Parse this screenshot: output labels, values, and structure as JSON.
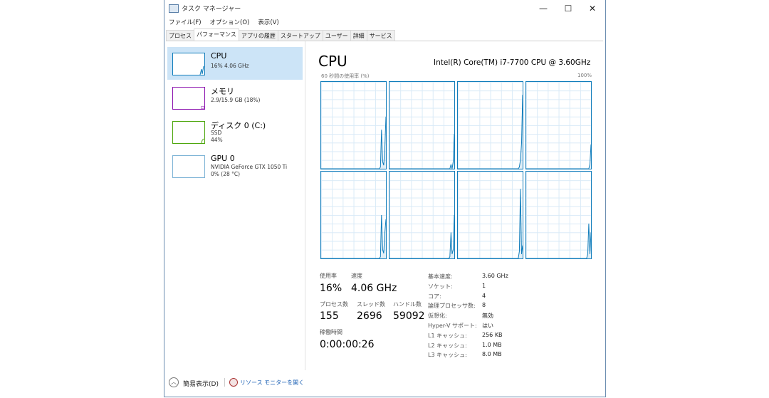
{
  "window": {
    "title": "タスク マネージャー",
    "minimize": "—",
    "maximize": "☐",
    "close": "✕"
  },
  "menu": [
    "ファイル(F)",
    "オプション(O)",
    "表示(V)"
  ],
  "tabs": [
    {
      "label": "プロセス"
    },
    {
      "label": "パフォーマンス",
      "active": true
    },
    {
      "label": "アプリの履歴"
    },
    {
      "label": "スタートアップ"
    },
    {
      "label": "ユーザー"
    },
    {
      "label": "詳細"
    },
    {
      "label": "サービス"
    }
  ],
  "sidebar": [
    {
      "name": "CPU",
      "line1": "16%  4.06 GHz",
      "color": "#117dbb"
    },
    {
      "name": "メモリ",
      "line1": "2.9/15.9 GB (18%)",
      "color": "#8b12ae"
    },
    {
      "name": "ディスク 0 (C:)",
      "line1": "SSD",
      "line2": "44%",
      "color": "#4da60c"
    },
    {
      "name": "GPU 0",
      "line1": "NVIDIA GeForce GTX 1050 Ti",
      "line2": "0%  (28 °C)",
      "color": "#7eb4d6"
    }
  ],
  "main": {
    "title": "CPU",
    "model": "Intel(R) Core(TM) i7-7700 CPU @ 3.60GHz",
    "graph_label": "60 秒間の使用率 (%)",
    "max_label": "100%",
    "core_history": [
      [
        0,
        0,
        0,
        0,
        0,
        0,
        0,
        0,
        0,
        0,
        0,
        0,
        0,
        0,
        0,
        0,
        0,
        0,
        0,
        0,
        0,
        0,
        0,
        0,
        0,
        0,
        0,
        0,
        0,
        0,
        0,
        0,
        0,
        0,
        0,
        0,
        0,
        0,
        0,
        0,
        0,
        0,
        0,
        0,
        0,
        0,
        0,
        0,
        0,
        0,
        0,
        0,
        0,
        0,
        2,
        45,
        8,
        4,
        25,
        60
      ],
      [
        0,
        0,
        0,
        0,
        0,
        0,
        0,
        0,
        0,
        0,
        0,
        0,
        0,
        0,
        0,
        0,
        0,
        0,
        0,
        0,
        0,
        0,
        0,
        0,
        0,
        0,
        0,
        0,
        0,
        0,
        0,
        0,
        0,
        0,
        0,
        0,
        0,
        0,
        0,
        0,
        0,
        0,
        0,
        0,
        0,
        0,
        0,
        0,
        0,
        0,
        0,
        0,
        0,
        0,
        0,
        0,
        5,
        0,
        8,
        40
      ],
      [
        0,
        0,
        0,
        0,
        0,
        0,
        0,
        0,
        0,
        0,
        0,
        0,
        0,
        0,
        0,
        0,
        0,
        0,
        0,
        0,
        0,
        0,
        0,
        0,
        0,
        0,
        0,
        0,
        0,
        0,
        0,
        0,
        0,
        0,
        0,
        0,
        0,
        0,
        0,
        0,
        0,
        0,
        0,
        0,
        0,
        0,
        0,
        0,
        0,
        0,
        0,
        0,
        0,
        0,
        0,
        0,
        2,
        10,
        30,
        85
      ],
      [
        0,
        0,
        0,
        0,
        0,
        0,
        0,
        0,
        0,
        0,
        0,
        0,
        0,
        0,
        0,
        0,
        0,
        0,
        0,
        0,
        0,
        0,
        0,
        0,
        0,
        0,
        0,
        0,
        0,
        0,
        0,
        0,
        0,
        0,
        0,
        0,
        0,
        0,
        0,
        0,
        0,
        0,
        0,
        0,
        0,
        0,
        0,
        0,
        0,
        0,
        0,
        0,
        0,
        0,
        0,
        0,
        0,
        0,
        5,
        28
      ],
      [
        0,
        0,
        0,
        0,
        0,
        0,
        0,
        0,
        0,
        0,
        0,
        0,
        0,
        0,
        0,
        0,
        0,
        0,
        0,
        0,
        0,
        0,
        0,
        0,
        0,
        0,
        0,
        0,
        0,
        0,
        0,
        0,
        0,
        0,
        0,
        0,
        0,
        0,
        0,
        0,
        0,
        0,
        0,
        0,
        0,
        0,
        0,
        0,
        0,
        0,
        0,
        0,
        0,
        0,
        2,
        50,
        10,
        6,
        30,
        45
      ],
      [
        0,
        0,
        0,
        0,
        0,
        0,
        0,
        0,
        0,
        0,
        0,
        0,
        0,
        0,
        0,
        0,
        0,
        0,
        0,
        0,
        0,
        0,
        0,
        0,
        0,
        0,
        0,
        0,
        0,
        0,
        0,
        0,
        0,
        0,
        0,
        0,
        0,
        0,
        0,
        0,
        0,
        0,
        0,
        0,
        0,
        0,
        0,
        0,
        0,
        0,
        0,
        0,
        0,
        0,
        0,
        2,
        30,
        5,
        10,
        50
      ],
      [
        0,
        0,
        0,
        0,
        0,
        0,
        0,
        0,
        0,
        0,
        0,
        0,
        0,
        0,
        0,
        0,
        0,
        0,
        0,
        0,
        0,
        0,
        0,
        0,
        0,
        0,
        0,
        0,
        0,
        0,
        0,
        0,
        0,
        0,
        0,
        0,
        0,
        0,
        0,
        0,
        0,
        0,
        0,
        0,
        0,
        0,
        0,
        0,
        0,
        0,
        0,
        0,
        0,
        0,
        0,
        0,
        8,
        80,
        5,
        15
      ],
      [
        0,
        0,
        0,
        0,
        0,
        0,
        0,
        0,
        0,
        0,
        0,
        0,
        0,
        0,
        0,
        0,
        0,
        0,
        0,
        0,
        0,
        0,
        0,
        0,
        0,
        0,
        0,
        0,
        0,
        0,
        0,
        0,
        0,
        0,
        0,
        0,
        0,
        0,
        0,
        0,
        0,
        0,
        0,
        0,
        0,
        0,
        0,
        0,
        0,
        0,
        0,
        0,
        0,
        0,
        0,
        0,
        5,
        40,
        5,
        30
      ]
    ],
    "stats": {
      "usage_label": "使用率",
      "usage": "16%",
      "speed_label": "速度",
      "speed": "4.06 GHz",
      "proc_label": "プロセス数",
      "proc": "155",
      "thread_label": "スレッド数",
      "thread": "2696",
      "handle_label": "ハンドル数",
      "handle": "59092",
      "uptime_label": "稼働時間",
      "uptime": "0:00:00:26"
    },
    "specs": [
      [
        "基本速度:",
        "3.60 GHz"
      ],
      [
        "ソケット:",
        "1"
      ],
      [
        "コア:",
        "4"
      ],
      [
        "論理プロセッサ数:",
        "8"
      ],
      [
        "仮想化:",
        "無効"
      ],
      [
        "Hyper-V サポート:",
        "はい"
      ],
      [
        "L1 キャッシュ:",
        "256 KB"
      ],
      [
        "L2 キャッシュ:",
        "1.0 MB"
      ],
      [
        "L3 キャッシュ:",
        "8.0 MB"
      ]
    ]
  },
  "footer": {
    "fewer": "簡易表示(D)",
    "monitor": "リソース モニターを開く"
  }
}
